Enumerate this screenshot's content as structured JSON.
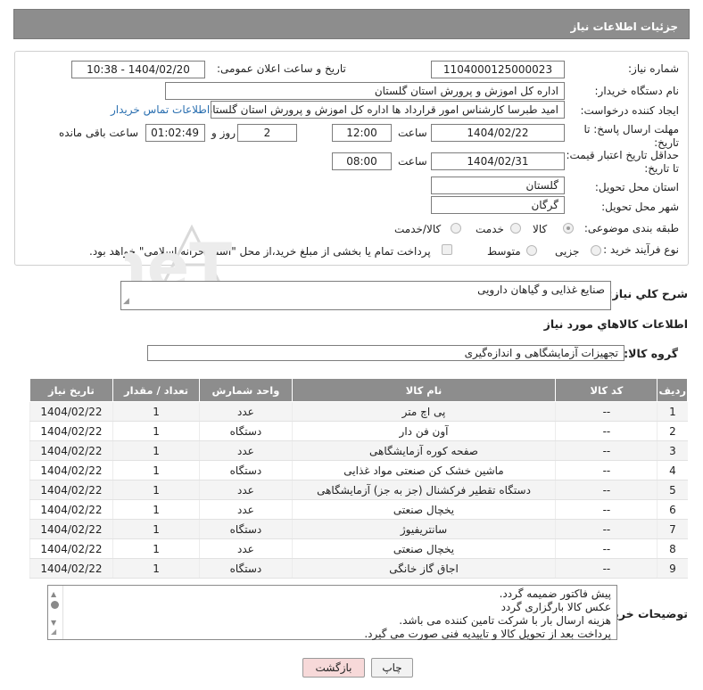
{
  "header": {
    "title": "جزئیات اطلاعات نیاز"
  },
  "form": {
    "need_number_label": "شماره نیاز:",
    "need_number": "1104000125000023",
    "announce_label": "تاریخ و ساعت اعلان عمومی:",
    "announce_value": "1404/02/20 - 10:38",
    "buyer_org_label": "نام دستگاه خریدار:",
    "buyer_org": "اداره کل اموزش و پرورش استان گلستان",
    "creator_label": "ایجاد کننده درخواست:",
    "creator": "امید طبرسا کارشناس امور قرارداد ها اداره کل اموزش و پرورش استان گلستان",
    "contact_link": "اطلاعات تماس خریدار",
    "deadline_label_1": "مهلت ارسال پاسخ: تا",
    "deadline_label_2": "تاریخ:",
    "deadline_date": "1404/02/22",
    "time_label": "ساعت",
    "deadline_time": "12:00",
    "days_value": "2",
    "days_label": "روز و",
    "remaining_time": "01:02:49",
    "remaining_label": "ساعت باقی مانده",
    "validity_label_1": "حداقل تاریخ اعتبار قیمت:",
    "validity_label_2": "تا تاریخ:",
    "validity_date": "1404/02/31",
    "validity_time_label": "ساعت",
    "validity_time": "08:00",
    "province_label": "استان محل تحویل:",
    "province": "گلستان",
    "city_label": "شهر محل تحویل:",
    "city": "گرگان",
    "category_label": "طبقه بندی موضوعی:",
    "category_options": [
      "کالا",
      "خدمت",
      "کالا/خدمت"
    ],
    "process_label": "نوع فرآیند خرید :",
    "process_options": [
      "جزیی",
      "متوسط"
    ],
    "payment_note": "پرداخت تمام یا بخشی از مبلغ خرید،از محل \"اسناد خزانه اسلامی\" خواهد بود."
  },
  "summary": {
    "label": "شرح کلي نياز:",
    "value": "صنایع غذایی و گیاهان دارویی"
  },
  "goods_section": {
    "title": "اطلاعات کالاهاي مورد نياز"
  },
  "goods_group": {
    "label": "گروه کالا:",
    "value": "تجهیزات آزمایشگاهی و اندازه‌گیری"
  },
  "table": {
    "headers": [
      "ردیف",
      "کد کالا",
      "نام کالا",
      "واحد شمارش",
      "تعداد / مقدار",
      "تاریخ نیاز"
    ],
    "rows": [
      [
        "1",
        "--",
        "پی اچ متر",
        "عدد",
        "1",
        "1404/02/22"
      ],
      [
        "2",
        "--",
        "آون فن دار",
        "دستگاه",
        "1",
        "1404/02/22"
      ],
      [
        "3",
        "--",
        "صفحه کوره آزمایشگاهی",
        "عدد",
        "1",
        "1404/02/22"
      ],
      [
        "4",
        "--",
        "ماشین خشک کن صنعتی مواد غذایی",
        "دستگاه",
        "1",
        "1404/02/22"
      ],
      [
        "5",
        "--",
        "دستگاه تقطیر فرکشنال (جز به جز) آزمایشگاهی",
        "عدد",
        "1",
        "1404/02/22"
      ],
      [
        "6",
        "--",
        "یخچال صنعتی",
        "عدد",
        "1",
        "1404/02/22"
      ],
      [
        "7",
        "--",
        "سانتریفیوژ",
        "دستگاه",
        "1",
        "1404/02/22"
      ],
      [
        "8",
        "--",
        "یخچال صنعتی",
        "عدد",
        "1",
        "1404/02/22"
      ],
      [
        "9",
        "--",
        "اجاق گاز خانگی",
        "دستگاه",
        "1",
        "1404/02/22"
      ]
    ]
  },
  "notes": {
    "label": "توضیحات خریدار:",
    "lines": [
      "پیش  فاکتور ضمیمه گردد.",
      "عکس کالا بارگزاری گردد",
      "هزینه ارسال بار با شرکت تامین کننده می باشد.",
      "پرداخت بعد از تحویل کالا و تاییدیه فنی صورت می گیرد."
    ]
  },
  "buttons": {
    "print": "چاپ",
    "back": "بازگشت"
  },
  "watermark": {
    "text": "AriaTender.neT"
  },
  "colors": {
    "header_bg": "#8d8d8d",
    "link": "#2a6fb0",
    "back_button_bg": "#f7d9d9"
  }
}
